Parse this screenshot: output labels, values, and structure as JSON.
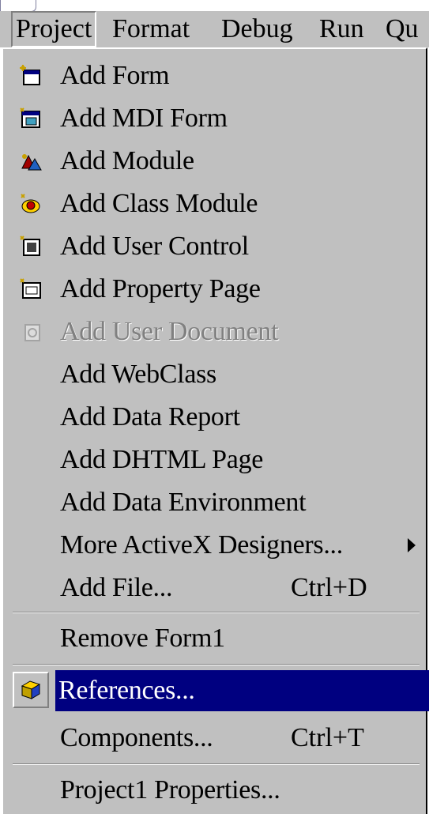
{
  "menubar": {
    "items": [
      {
        "label": "Project"
      },
      {
        "label": "Format"
      },
      {
        "label": "Debug"
      },
      {
        "label": "Run"
      },
      {
        "label": "Qu"
      }
    ]
  },
  "menu": {
    "items": [
      {
        "label": "Add Form",
        "icon": "add-form-icon"
      },
      {
        "label": "Add MDI Form",
        "icon": "add-mdi-form-icon"
      },
      {
        "label": "Add Module",
        "icon": "add-module-icon"
      },
      {
        "label": "Add Class Module",
        "icon": "add-class-module-icon"
      },
      {
        "label": "Add User Control",
        "icon": "add-user-control-icon"
      },
      {
        "label": "Add Property Page",
        "icon": "add-property-page-icon"
      },
      {
        "label": "Add User Document",
        "icon": "add-user-document-icon",
        "disabled": true
      },
      {
        "label": "Add WebClass"
      },
      {
        "label": "Add Data Report"
      },
      {
        "label": "Add DHTML Page"
      },
      {
        "label": "Add Data Environment"
      },
      {
        "label": "More ActiveX Designers...",
        "submenu": true
      },
      {
        "label": "Add File...",
        "shortcut": "Ctrl+D"
      },
      {
        "label": "Remove Form1"
      },
      {
        "label": "References...",
        "icon": "references-icon",
        "highlighted": true
      },
      {
        "label": "Components...",
        "shortcut": "Ctrl+T"
      },
      {
        "label": "Project1 Properties..."
      }
    ]
  },
  "colors": {
    "menu_bg": "#c0c0c0",
    "highlight": "#000080",
    "disabled_text": "#808080"
  }
}
